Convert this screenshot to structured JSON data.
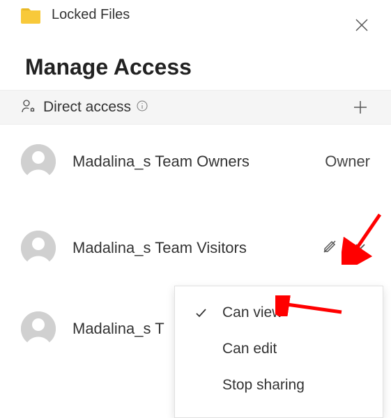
{
  "header": {
    "folder_name": "Locked Files"
  },
  "title": "Manage Access",
  "section": {
    "label": "Direct access"
  },
  "entries": [
    {
      "name": "Madalina_s Team Owners",
      "role": "Owner"
    },
    {
      "name": "Madalina_s Team Visitors"
    },
    {
      "name": "Madalina_s T"
    }
  ],
  "dropdown": {
    "items": [
      {
        "label": "Can view",
        "selected": true
      },
      {
        "label": "Can edit",
        "selected": false
      },
      {
        "label": "Stop sharing",
        "selected": false
      }
    ]
  }
}
